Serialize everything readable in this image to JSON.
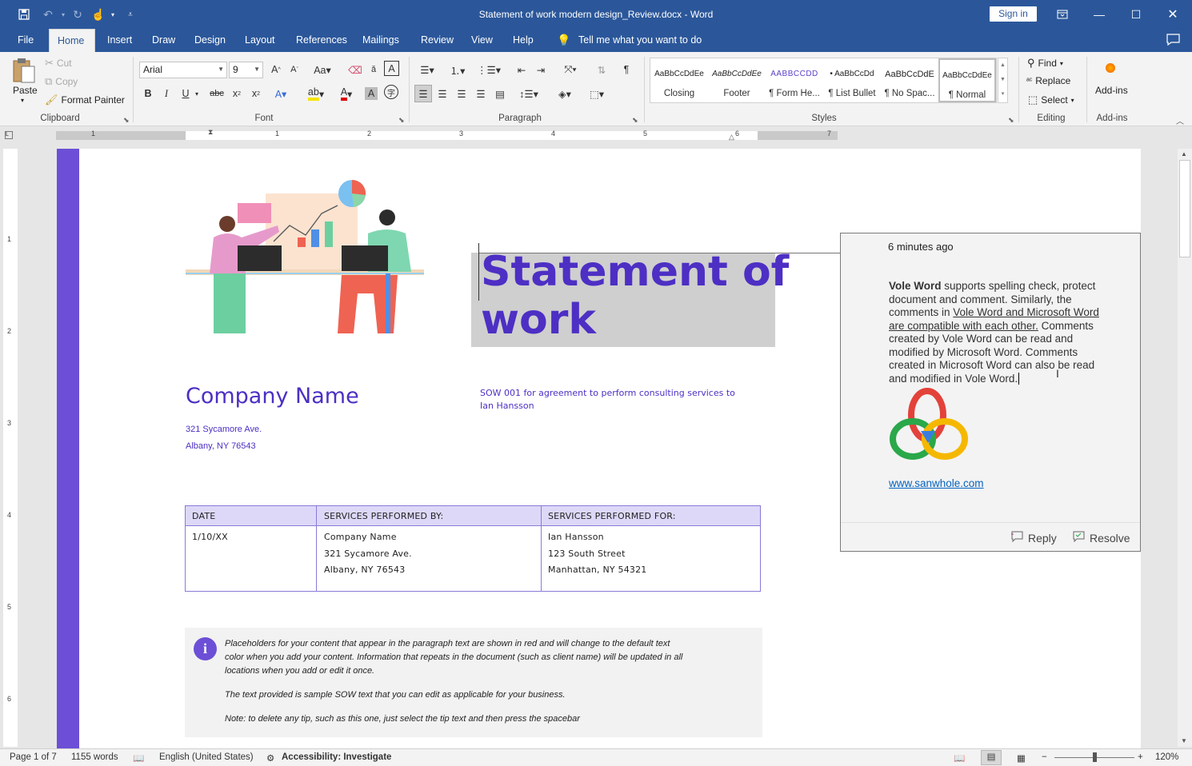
{
  "window": {
    "title": "Statement of work modern design_Review.docx - Word",
    "sign_in": "Sign in"
  },
  "tabs": [
    "File",
    "Home",
    "Insert",
    "Draw",
    "Design",
    "Layout",
    "References",
    "Mailings",
    "Review",
    "View",
    "Help"
  ],
  "tell_me": "Tell me what you want to do",
  "clipboard": {
    "paste": "Paste",
    "cut": "Cut",
    "copy": "Copy",
    "format_painter": "Format Painter",
    "label": "Clipboard"
  },
  "font": {
    "name": "Arial",
    "size": "9",
    "label": "Font"
  },
  "paragraph": {
    "label": "Paragraph"
  },
  "styles": {
    "label": "Styles",
    "items": [
      {
        "preview": "AaBbCcDdEe",
        "name": "Closing"
      },
      {
        "preview": "AaBbCcDdEe",
        "name": "Footer"
      },
      {
        "preview": "AABBCCDD",
        "name": "¶ Form He..."
      },
      {
        "preview": "• AaBbCcDd",
        "name": "¶ List Bullet"
      },
      {
        "preview": "AaBbCcDdE",
        "name": "¶ No Spac..."
      },
      {
        "preview": "AaBbCcDdEe",
        "name": "¶ Normal"
      }
    ]
  },
  "editing": {
    "find": "Find",
    "replace": "Replace",
    "select": "Select",
    "label": "Editing"
  },
  "addins": {
    "btn": "Add-ins",
    "label": "Add-ins"
  },
  "ruler": {
    "h": [
      "1",
      "1",
      "2",
      "3",
      "4",
      "5",
      "6",
      "7"
    ],
    "v": [
      "1",
      "2",
      "3",
      "4",
      "5",
      "6"
    ]
  },
  "doc": {
    "title_line1": "Statement of",
    "title_line2": "work",
    "company": "Company Name",
    "addr1": "321 Sycamore Ave.",
    "addr2": "Albany, NY 76543",
    "sow_line1": "SOW 001 for agreement to perform consulting services to",
    "sow_line2": "Ian Hansson",
    "table": {
      "headers": [
        "DATE",
        "SERVICES PERFORMED BY:",
        "SERVICES PERFORMED FOR:"
      ],
      "date": "1/10/XX",
      "by": [
        "Company Name",
        "321 Sycamore Ave.",
        "Albany, NY 76543"
      ],
      "for": [
        "Ian Hansson",
        "123 South Street",
        "Manhattan, NY 54321"
      ]
    },
    "note": {
      "l1": "Placeholders for your content that appear in the paragraph text are shown in red and will change to the default text",
      "l2": "color when you add your content. Information that repeats in the document (such as client name) will be updated in all",
      "l3": "locations when you add or edit it once.",
      "p2": "The text provided is sample SOW text that you can edit as applicable for your business.",
      "p3": "Note: to delete any tip, such as this one, just select the tip text and then press the spacebar"
    }
  },
  "comment": {
    "time": "6 minutes ago",
    "bold": "Vole Word",
    "t1": " supports spelling check, protect",
    "t2": "document and comment. Similarly, the",
    "t3": "comments in ",
    "u1": "Vole Word and Microsoft Word",
    "u2": "are compatible with each other.",
    "t4": " Comments",
    "t5": "created by Vole Word can be read and",
    "t6": "modified by Microsoft Word. Comments",
    "t7": "created in Microsoft Word can also be read",
    "t8": "and modified in Vole Word.",
    "link": "www.sanwhole.com",
    "reply": "Reply",
    "resolve": "Resolve"
  },
  "status": {
    "page": "Page 1 of 7",
    "words": "1155 words",
    "lang": "English (United States)",
    "access": "Accessibility: Investigate",
    "zoom": "120%"
  }
}
